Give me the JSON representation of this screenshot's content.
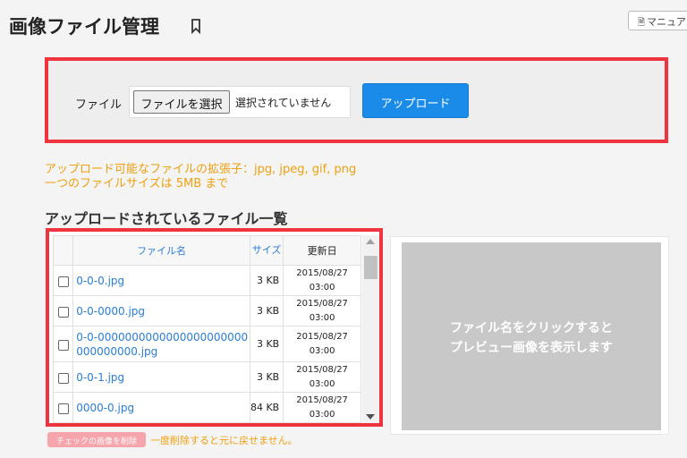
{
  "header": {
    "title": "画像ファイル管理",
    "manual_label": "マニュアル"
  },
  "upload": {
    "file_label": "ファイル",
    "choose_label": "ファイルを選択",
    "no_file_text": "選択されていません",
    "upload_label": "アップロード"
  },
  "notes": {
    "extensions": "アップロード可能なファイルの拡張子：jpg, jpeg, gif, png",
    "max_size": "一つのファイルサイズは 5MB まで"
  },
  "list": {
    "title": "アップロードされているファイル一覧",
    "headers": {
      "name": "ファイル名",
      "size": "サイズ",
      "date": "更新日"
    },
    "rows": [
      {
        "name": "0-0-0.jpg",
        "size": "3 KB",
        "date": "2015/08/27",
        "time": "03:00"
      },
      {
        "name": "0-0-0000.jpg",
        "size": "3 KB",
        "date": "2015/08/27",
        "time": "03:00"
      },
      {
        "name": "0-0-0000000000000000000000000000000.jpg",
        "size": "3 KB",
        "date": "2015/08/27",
        "time": "03:00"
      },
      {
        "name": "0-0-1.jpg",
        "size": "3 KB",
        "date": "2015/08/27",
        "time": "03:00"
      },
      {
        "name": "0000-0.jpg",
        "size": "84 KB",
        "date": "2015/08/27",
        "time": "03:00"
      }
    ]
  },
  "preview": {
    "line1": "ファイル名をクリックすると",
    "line2": "プレビュー画像を表示します"
  },
  "actions": {
    "delete_label": "チェックの画像を削除",
    "delete_warning": "一度削除すると元に戻せません。"
  },
  "colors": {
    "highlight_border": "#f0343f",
    "accent_blue": "#1a8be8",
    "link_blue": "#2a7ed8",
    "note_orange": "#f0a010"
  }
}
